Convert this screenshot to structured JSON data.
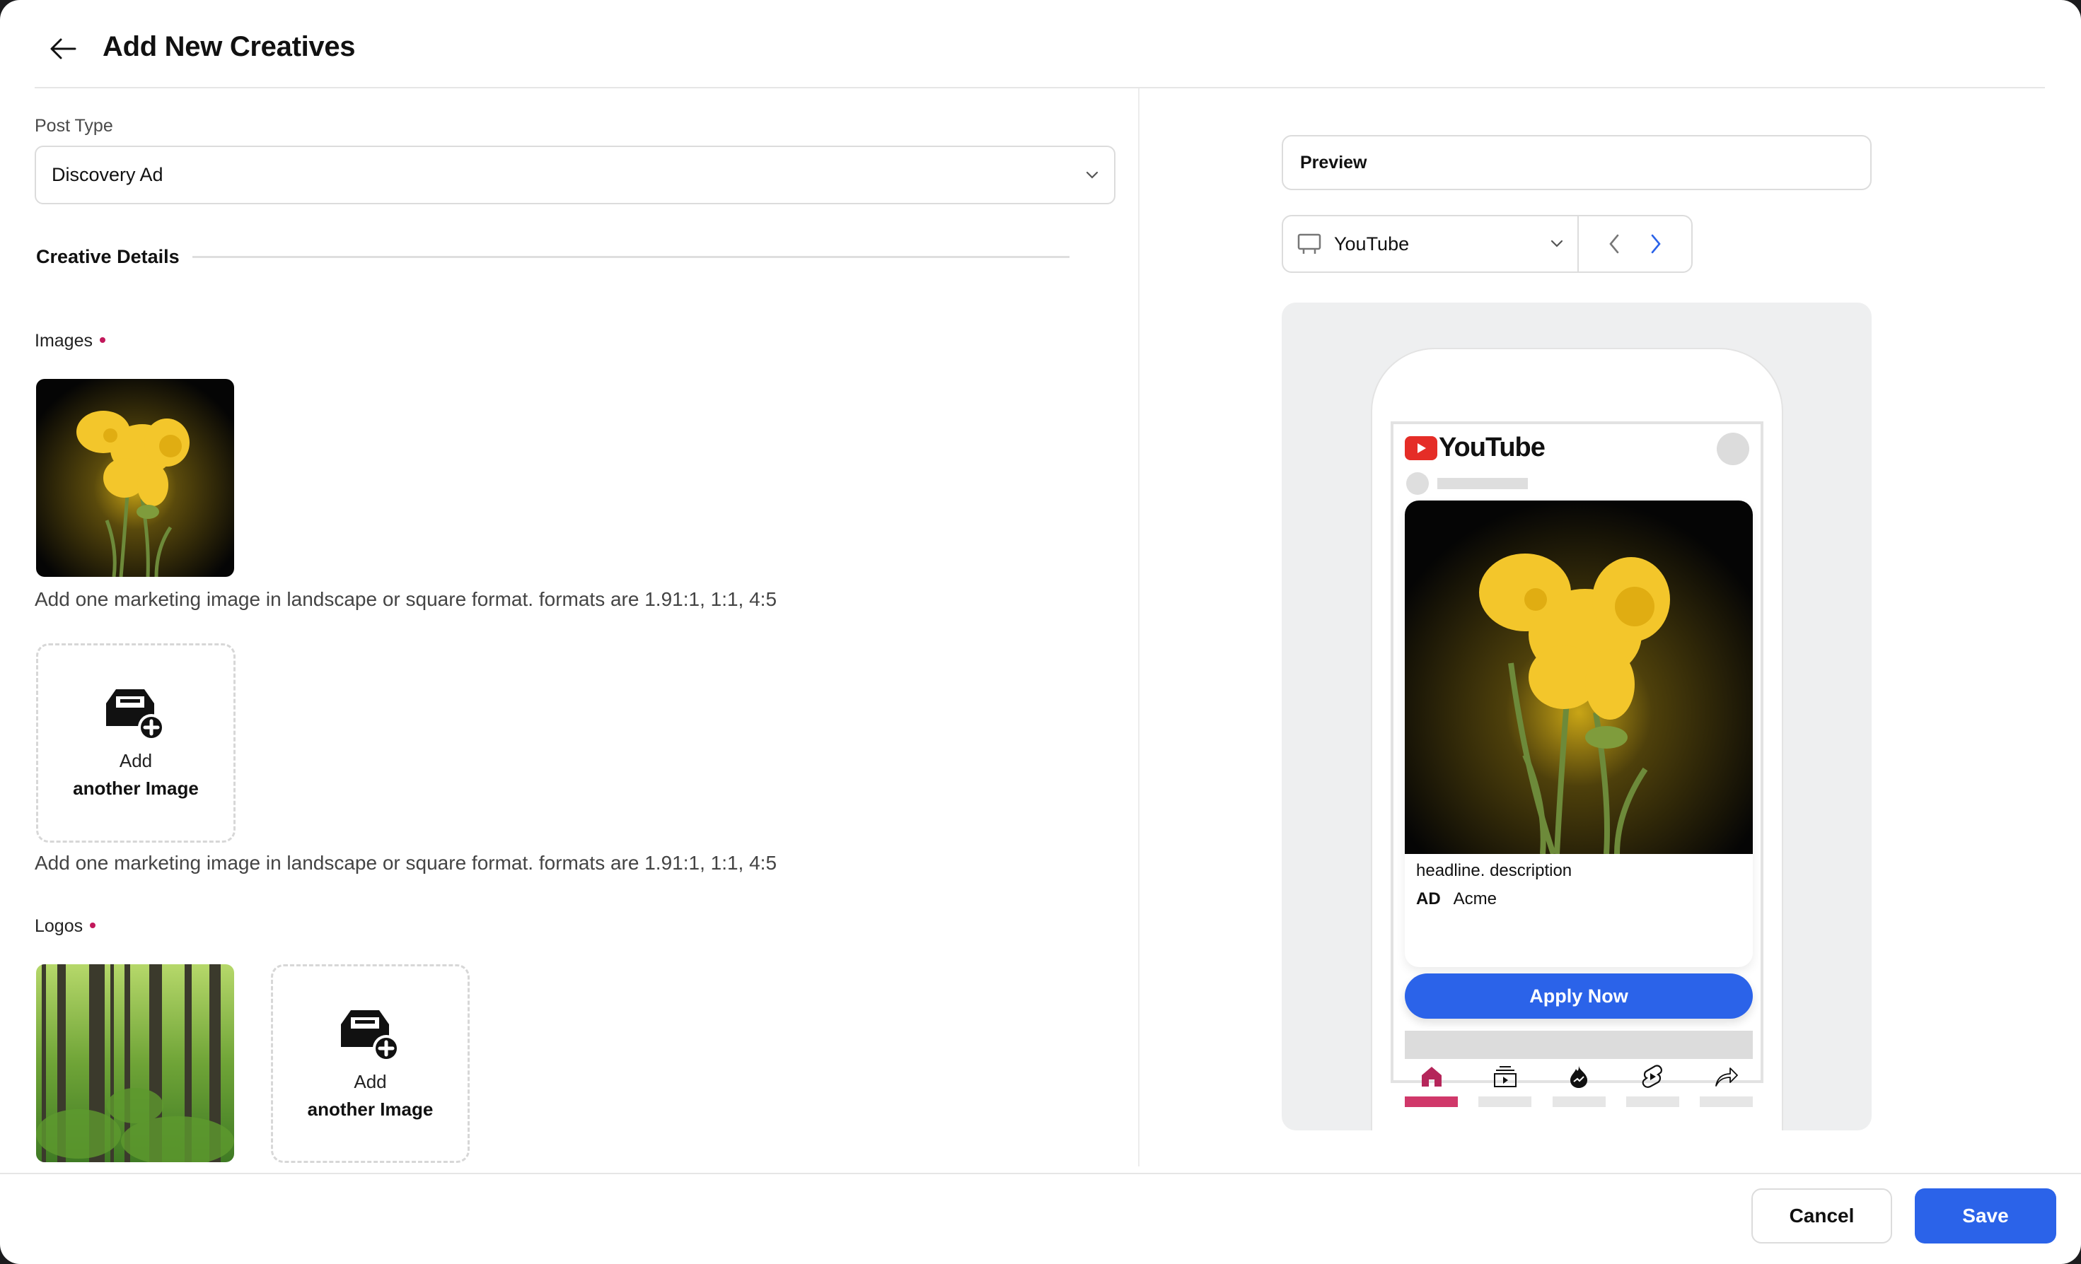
{
  "header": {
    "title": "Add New Creatives",
    "back_icon": "arrow-left-icon"
  },
  "form": {
    "post_type": {
      "label": "Post Type",
      "value": "Discovery Ad"
    },
    "creative_details_title": "Creative Details",
    "images": {
      "label": "Images",
      "required": true,
      "items": [
        {
          "alt": "Yellow daffodil on dark background"
        }
      ],
      "hint": "Add one marketing image in landscape or square format. formats are 1.91:1, 1:1, 4:5",
      "add_tile": {
        "line1": "Add",
        "line2": "another Image"
      },
      "hint_2": "Add one marketing image in landscape or square format. formats are 1.91:1, 1:1, 4:5"
    },
    "logos": {
      "label": "Logos",
      "required": true,
      "items": [
        {
          "alt": "Green forest trees"
        }
      ],
      "add_tile": {
        "line1": "Add",
        "line2": "another Image"
      }
    }
  },
  "preview": {
    "label": "Preview",
    "platform": "YouTube",
    "platform_icon": "monitor-icon",
    "prev_icon": "chevron-left-icon",
    "next_icon": "chevron-right-icon",
    "phone": {
      "app_name": "YouTube",
      "headline": "headline. description",
      "ad_badge": "AD",
      "advertiser": "Acme",
      "cta": "Apply Now",
      "tabs": [
        {
          "icon": "home-icon",
          "active": true
        },
        {
          "icon": "subscriptions-icon",
          "active": false
        },
        {
          "icon": "trending-icon",
          "active": false
        },
        {
          "icon": "shorts-icon",
          "active": false
        },
        {
          "icon": "share-icon",
          "active": false
        }
      ]
    }
  },
  "footer": {
    "cancel_label": "Cancel",
    "save_label": "Save"
  },
  "colors": {
    "primary": "#2b63e9",
    "required_dot": "#c2185b",
    "active_tab": "#d0386a",
    "youtube_red": "#e52d27"
  }
}
